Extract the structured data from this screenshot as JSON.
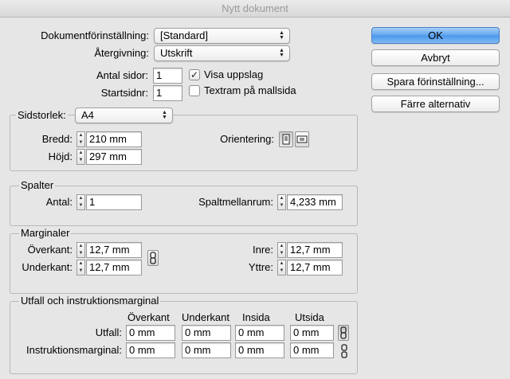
{
  "window": {
    "title": "Nytt dokument"
  },
  "doc": {
    "preset_label": "Dokumentförinställning:",
    "preset_value": "[Standard]",
    "intent_label": "Återgivning:",
    "intent_value": "Utskrift",
    "pages_label": "Antal sidor:",
    "pages_value": "1",
    "start_label": "Startsidnr:",
    "start_value": "1",
    "facing_label": "Visa uppslag",
    "facing_checked": true,
    "master_label": "Textram på mallsida",
    "master_checked": false
  },
  "buttons": {
    "ok": "OK",
    "cancel": "Avbryt",
    "save_preset": "Spara förinställning...",
    "fewer": "Färre alternativ"
  },
  "pagesize": {
    "label": "Sidstorlek:",
    "value": "A4",
    "width_label": "Bredd:",
    "width_value": "210 mm",
    "height_label": "Höjd:",
    "height_value": "297 mm",
    "orientation_label": "Orientering:"
  },
  "columns": {
    "title": "Spalter",
    "count_label": "Antal:",
    "count_value": "1",
    "gutter_label": "Spaltmellanrum:",
    "gutter_value": "4,233 mm"
  },
  "margins": {
    "title": "Marginaler",
    "top_label": "Överkant:",
    "top_value": "12,7 mm",
    "bottom_label": "Underkant:",
    "bottom_value": "12,7 mm",
    "inside_label": "Inre:",
    "inside_value": "12,7 mm",
    "outside_label": "Yttre:",
    "outside_value": "12,7 mm"
  },
  "bleed": {
    "title": "Utfall och instruktionsmarginal",
    "col_headers": [
      "Överkant",
      "Underkant",
      "Insida",
      "Utsida"
    ],
    "bleed_label": "Utfall:",
    "bleed_values": [
      "0 mm",
      "0 mm",
      "0 mm",
      "0 mm"
    ],
    "slug_label": "Instruktionsmarginal:",
    "slug_values": [
      "0 mm",
      "0 mm",
      "0 mm",
      "0 mm"
    ]
  }
}
